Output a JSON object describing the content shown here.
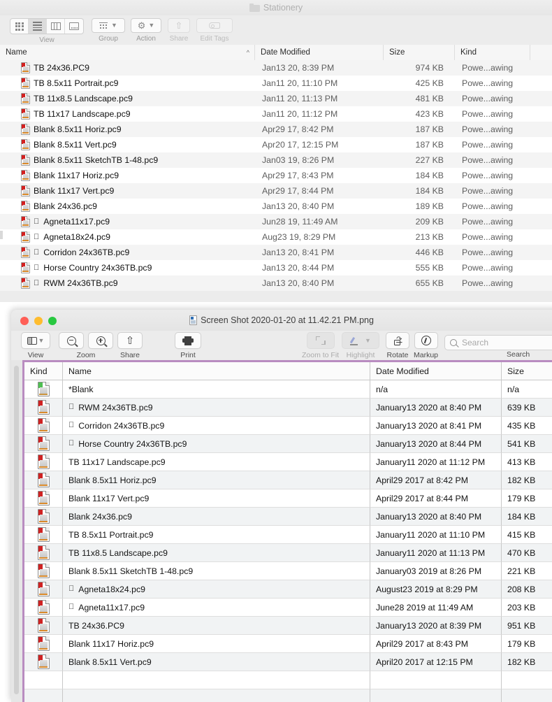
{
  "finder": {
    "title": "Stationery",
    "toolbar": {
      "view_label": "View",
      "group_label": "Group",
      "action_label": "Action",
      "share_label": "Share",
      "edit_tags_label": "Edit Tags"
    },
    "columns": [
      "Name",
      "Date Modified",
      "Size",
      "Kind"
    ],
    "sort_indicator": "^",
    "rows": [
      {
        "name": "TB 24x36.PC9",
        "apple": false,
        "date": "Jan13 20, 8:39 PM",
        "size": "974 KB",
        "kind": "Powe...awing"
      },
      {
        "name": "TB 8.5x11 Portrait.pc9",
        "apple": false,
        "date": "Jan11 20, 11:10 PM",
        "size": "425 KB",
        "kind": "Powe...awing"
      },
      {
        "name": "TB 11x8.5 Landscape.pc9",
        "apple": false,
        "date": "Jan11 20, 11:13 PM",
        "size": "481 KB",
        "kind": "Powe...awing"
      },
      {
        "name": "TB 11x17 Landscape.pc9",
        "apple": false,
        "date": "Jan11 20, 11:12 PM",
        "size": "423 KB",
        "kind": "Powe...awing"
      },
      {
        "name": "Blank  8.5x11 Horiz.pc9",
        "apple": false,
        "date": "Apr29 17, 8:42 PM",
        "size": "187 KB",
        "kind": "Powe...awing"
      },
      {
        "name": "Blank  8.5x11 Vert.pc9",
        "apple": false,
        "date": "Apr20 17, 12:15 PM",
        "size": "187 KB",
        "kind": "Powe...awing"
      },
      {
        "name": "Blank 8.5x11 SketchTB 1-48.pc9",
        "apple": false,
        "date": "Jan03 19, 8:26 PM",
        "size": "227 KB",
        "kind": "Powe...awing"
      },
      {
        "name": "Blank 11x17 Horiz.pc9",
        "apple": false,
        "date": "Apr29 17, 8:43 PM",
        "size": "184 KB",
        "kind": "Powe...awing"
      },
      {
        "name": "Blank 11x17 Vert.pc9",
        "apple": false,
        "date": "Apr29 17, 8:44 PM",
        "size": "184 KB",
        "kind": "Powe...awing"
      },
      {
        "name": "Blank 24x36.pc9",
        "apple": false,
        "date": "Jan13 20, 8:40 PM",
        "size": "189 KB",
        "kind": "Powe...awing"
      },
      {
        "name": "Agneta11x17.pc9",
        "apple": true,
        "date": "Jun28 19, 11:49 AM",
        "size": "209 KB",
        "kind": "Powe...awing"
      },
      {
        "name": "Agneta18x24.pc9",
        "apple": true,
        "date": "Aug23 19, 8:29 PM",
        "size": "213 KB",
        "kind": "Powe...awing"
      },
      {
        "name": "Corridon 24x36TB.pc9",
        "apple": true,
        "date": "Jan13 20, 8:41 PM",
        "size": "446 KB",
        "kind": "Powe...awing"
      },
      {
        "name": "Horse Country 24x36TB.pc9",
        "apple": true,
        "date": "Jan13 20, 8:44 PM",
        "size": "555 KB",
        "kind": "Powe...awing"
      },
      {
        "name": "RWM 24x36TB.pc9",
        "apple": true,
        "date": "Jan13 20, 8:40 PM",
        "size": "655 KB",
        "kind": "Powe...awing"
      }
    ]
  },
  "preview": {
    "title": "Screen Shot 2020-01-20 at 11.42.21 PM.png",
    "toolbar": {
      "view_label": "View",
      "zoom_label": "Zoom",
      "share_label": "Share",
      "print_label": "Print",
      "zoom_to_fit_label": "Zoom to Fit",
      "highlight_label": "Highlight",
      "rotate_label": "Rotate",
      "markup_label": "Markup",
      "search_label": "Search"
    },
    "search": {
      "value": "",
      "placeholder": "Search"
    },
    "window_controls": {
      "close": "#ff5f57",
      "minimize": "#febc2e",
      "zoom": "#28c840"
    }
  },
  "image_table": {
    "columns": [
      "Kind",
      "Name",
      "Date Modified",
      "Size"
    ],
    "rows": [
      {
        "name": "*Blank",
        "apple": false,
        "green": true,
        "date": "n/a",
        "size": "n/a"
      },
      {
        "name": "RWM 24x36TB.pc9",
        "apple": true,
        "green": false,
        "date": "January13 2020 at 8:40 PM",
        "size": "639 KB"
      },
      {
        "name": "Corridon 24x36TB.pc9",
        "apple": true,
        "green": false,
        "date": "January13 2020 at 8:41 PM",
        "size": "435 KB"
      },
      {
        "name": "Horse Country 24x36TB.pc9",
        "apple": true,
        "green": false,
        "date": "January13 2020 at 8:44 PM",
        "size": "541 KB"
      },
      {
        "name": " TB 11x17 Landscape.pc9",
        "apple": false,
        "green": false,
        "date": "January11 2020 at 11:12 PM",
        "size": "413 KB"
      },
      {
        "name": "Blank  8.5x11 Horiz.pc9",
        "apple": false,
        "green": false,
        "date": "April29 2017 at 8:42 PM",
        "size": "182 KB"
      },
      {
        "name": "Blank 11x17 Vert.pc9",
        "apple": false,
        "green": false,
        "date": "April29 2017 at 8:44 PM",
        "size": "179 KB"
      },
      {
        "name": "Blank 24x36.pc9",
        "apple": false,
        "green": false,
        "date": "January13 2020 at 8:40 PM",
        "size": "184 KB"
      },
      {
        "name": " TB 8.5x11 Portrait.pc9",
        "apple": false,
        "green": false,
        "date": "January11 2020 at 11:10 PM",
        "size": "415 KB"
      },
      {
        "name": " TB 11x8.5 Landscape.pc9",
        "apple": false,
        "green": false,
        "date": "January11 2020 at 11:13 PM",
        "size": "470 KB"
      },
      {
        "name": "Blank 8.5x11 SketchTB 1-48.pc9",
        "apple": false,
        "green": false,
        "date": "January03 2019 at 8:26 PM",
        "size": "221 KB"
      },
      {
        "name": "Agneta18x24.pc9",
        "apple": true,
        "green": false,
        "date": "August23 2019 at 8:29 PM",
        "size": "208 KB"
      },
      {
        "name": "Agneta11x17.pc9",
        "apple": true,
        "green": false,
        "date": "June28 2019 at 11:49 AM",
        "size": "203 KB"
      },
      {
        "name": " TB 24x36.PC9",
        "apple": false,
        "green": false,
        "date": "January13 2020 at 8:39 PM",
        "size": "951 KB"
      },
      {
        "name": "Blank 11x17 Horiz.pc9",
        "apple": false,
        "green": false,
        "date": "April29 2017 at 8:43 PM",
        "size": "179 KB"
      },
      {
        "name": "Blank  8.5x11 Vert.pc9",
        "apple": false,
        "green": false,
        "date": "April20 2017 at 12:15 PM",
        "size": "182 KB"
      },
      {
        "name": "",
        "apple": false,
        "green": false,
        "date": "",
        "size": ""
      },
      {
        "name": "",
        "apple": false,
        "green": false,
        "date": "",
        "size": ""
      }
    ]
  }
}
